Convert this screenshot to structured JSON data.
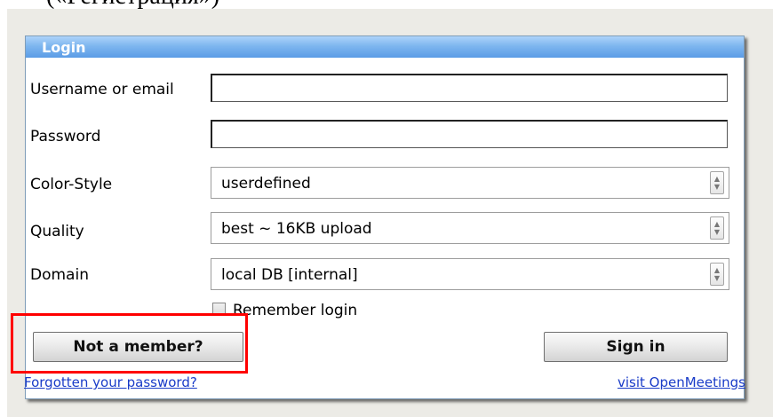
{
  "caption": "(«Регистрация»)",
  "panel": {
    "title": "Login"
  },
  "fields": {
    "username_label": "Username or email",
    "username_value": "",
    "password_label": "Password",
    "password_value": "",
    "color_style_label": "Color-Style",
    "color_style_value": "userdefined",
    "quality_label": "Quality",
    "quality_value": "best ~ 16KB upload",
    "domain_label": "Domain",
    "domain_value": "local DB [internal]"
  },
  "remember": {
    "label": "Remember login",
    "checked": false
  },
  "buttons": {
    "not_member": "Not a member?",
    "sign_in": "Sign in"
  },
  "links": {
    "forgot": "Forgotten your password?",
    "visit": "visit OpenMeetings"
  },
  "colors": {
    "title_bar": "#5b9ce6",
    "highlight": "#ff0000",
    "link": "#1a3cc8"
  }
}
